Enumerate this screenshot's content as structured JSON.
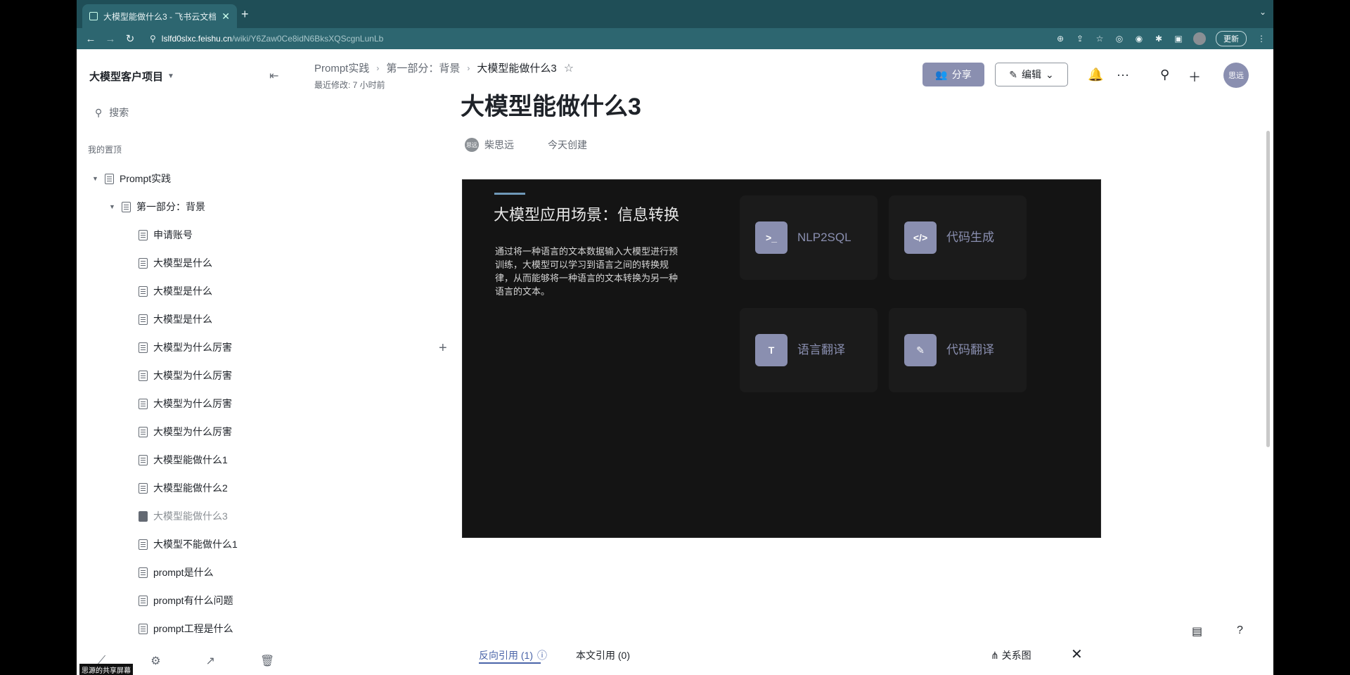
{
  "browser": {
    "tab_title": "大模型能做什么3 - 飞书云文档",
    "url_host": "lslfd0slxc.feishu.cn",
    "url_path": "/wiki/Y6Zaw0Ce8idN6BksXQScgnLunLb",
    "update_label": "更新"
  },
  "sidebar": {
    "space_title": "大模型客户项目",
    "search_label": "搜索",
    "pinned_label": "我的置顶",
    "items": [
      {
        "label": "Prompt实践"
      },
      {
        "label": "第一部分：背景"
      },
      {
        "label": "申请账号"
      },
      {
        "label": "大模型是什么"
      },
      {
        "label": "大模型是什么"
      },
      {
        "label": "大模型是什么"
      },
      {
        "label": "大模型为什么厉害"
      },
      {
        "label": "大模型为什么厉害"
      },
      {
        "label": "大模型为什么厉害"
      },
      {
        "label": "大模型为什么厉害"
      },
      {
        "label": "大模型能做什么1"
      },
      {
        "label": "大模型能做什么2"
      },
      {
        "label": "大模型能做什么3"
      },
      {
        "label": "大模型不能做什么1"
      },
      {
        "label": "prompt是什么"
      },
      {
        "label": "prompt有什么问题"
      },
      {
        "label": "prompt工程是什么"
      }
    ],
    "share_badge": "思源的共享屏幕"
  },
  "header": {
    "breadcrumb": [
      "Prompt实践",
      "第一部分：背景",
      "大模型能做什么3"
    ],
    "last_modified": "最近修改: 7 小时前",
    "share_label": "分享",
    "edit_label": "编辑",
    "avatar_text": "思远"
  },
  "document": {
    "title": "大模型能做什么3",
    "author_avatar": "思远",
    "author": "柴思远",
    "created": "今天创建"
  },
  "slide": {
    "title": "大模型应用场景：信息转换",
    "description": "通过将一种语言的文本数据输入大模型进行预训练，大模型可以学习到语言之间的转换规律，从而能够将一种语言的文本转换为另一种语言的文本。",
    "cards": [
      {
        "label": "NLP2SQL",
        "icon": "terminal-icon",
        "icon_glyph": ">_"
      },
      {
        "label": "代码生成",
        "icon": "code-icon",
        "icon_glyph": "</>"
      },
      {
        "label": "语言翻译",
        "icon": "text-icon",
        "icon_glyph": "T"
      },
      {
        "label": "代码翻译",
        "icon": "edit-doc-icon",
        "icon_glyph": "✎"
      }
    ]
  },
  "footer": {
    "backref_label": "反向引用 (1)",
    "ref_label": "本文引用 (0)",
    "graph_label": "关系图"
  },
  "colors": {
    "accent": "#8a8fb0",
    "link": "#4a64a8",
    "chrome": "#2d6670"
  }
}
